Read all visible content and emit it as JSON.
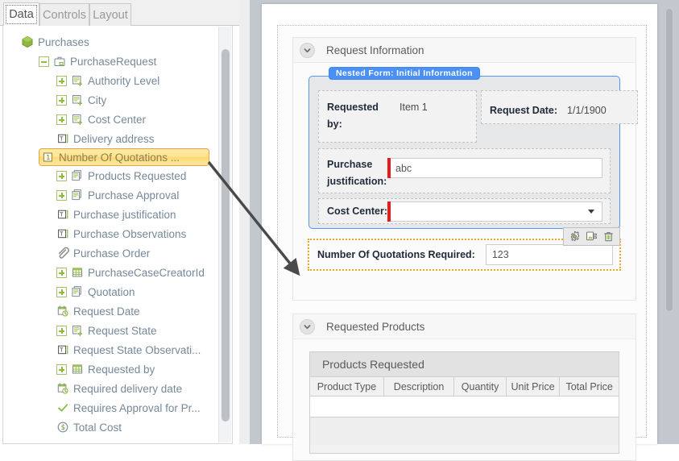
{
  "tabs": [
    {
      "label": "Data",
      "active": true
    },
    {
      "label": "Controls",
      "active": false
    },
    {
      "label": "Layout",
      "active": false
    }
  ],
  "tree": {
    "root": {
      "label": "Purchases",
      "icon": "package-icon"
    },
    "entity": {
      "label": "PurchaseRequest",
      "icon": "briefcase-icon"
    },
    "items": [
      {
        "label": "Authority Level",
        "icon": "related-entity-icon",
        "expandable": true
      },
      {
        "label": "City",
        "icon": "related-entity-icon",
        "expandable": true
      },
      {
        "label": "Cost Center",
        "icon": "related-entity-icon",
        "expandable": true
      },
      {
        "label": "Delivery address",
        "icon": "text-field-icon",
        "expandable": false
      },
      {
        "label": "Number Of Quotations ...",
        "icon": "number-field-icon",
        "expandable": false,
        "selected": true
      },
      {
        "label": "Products Requested",
        "icon": "collection-icon",
        "expandable": true
      },
      {
        "label": "Purchase Approval",
        "icon": "collection-icon",
        "expandable": true
      },
      {
        "label": "Purchase justification",
        "icon": "text-field-icon",
        "expandable": false
      },
      {
        "label": "Purchase Observations",
        "icon": "text-field-icon",
        "expandable": false
      },
      {
        "label": "Purchase Order",
        "icon": "attachment-icon",
        "expandable": false
      },
      {
        "label": "PurchaseCaseCreatorId",
        "icon": "grid-icon",
        "expandable": true
      },
      {
        "label": "Quotation",
        "icon": "collection-icon",
        "expandable": true
      },
      {
        "label": "Request Date",
        "icon": "date-icon",
        "expandable": false
      },
      {
        "label": "Request State",
        "icon": "related-entity-icon",
        "expandable": true
      },
      {
        "label": "Request State Observati...",
        "icon": "text-field-icon",
        "expandable": false
      },
      {
        "label": "Requested by",
        "icon": "grid-icon",
        "expandable": true
      },
      {
        "label": "Required delivery date",
        "icon": "date-icon",
        "expandable": false
      },
      {
        "label": "Requires Approval for Pr...",
        "icon": "check-icon",
        "expandable": false
      },
      {
        "label": "Total Cost",
        "icon": "currency-icon",
        "expandable": false
      }
    ]
  },
  "designer": {
    "section_request": {
      "title": "Request Information",
      "chevron": "chevron-down-icon",
      "nested_form": {
        "badge": "Nested Form: Initial Information",
        "fields": [
          {
            "label": "Requested by:",
            "value": "Item 1"
          },
          {
            "label": "Request Date:",
            "value": "1/1/1900"
          },
          {
            "label": "Purchase justification:",
            "value": "abc",
            "required": true
          },
          {
            "label": "Cost Center:",
            "value": "",
            "required": true,
            "type": "dropdown"
          }
        ]
      },
      "selected_field": {
        "label": "Number Of Quotations Required:",
        "value": "123",
        "toolbar": [
          {
            "name": "settings-icon",
            "title": "Settings"
          },
          {
            "name": "duplicate-icon",
            "title": "Duplicate"
          },
          {
            "name": "delete-icon",
            "title": "Delete"
          }
        ]
      }
    },
    "section_products": {
      "title": "Requested Products",
      "chevron": "chevron-down-icon",
      "grid": {
        "title": "Products Requested",
        "columns": [
          "Product Type",
          "Description",
          "Quantity",
          "Unit Price",
          "Total Price"
        ],
        "rows": []
      }
    }
  },
  "colors": {
    "accent_blue": "#4a90f5",
    "selection_yellow": "#ffe48f",
    "selection_border": "#e8a33d",
    "required_red": "#e81a1a",
    "tree_text": "#75889b",
    "dotted_highlight": "#f0a823"
  }
}
